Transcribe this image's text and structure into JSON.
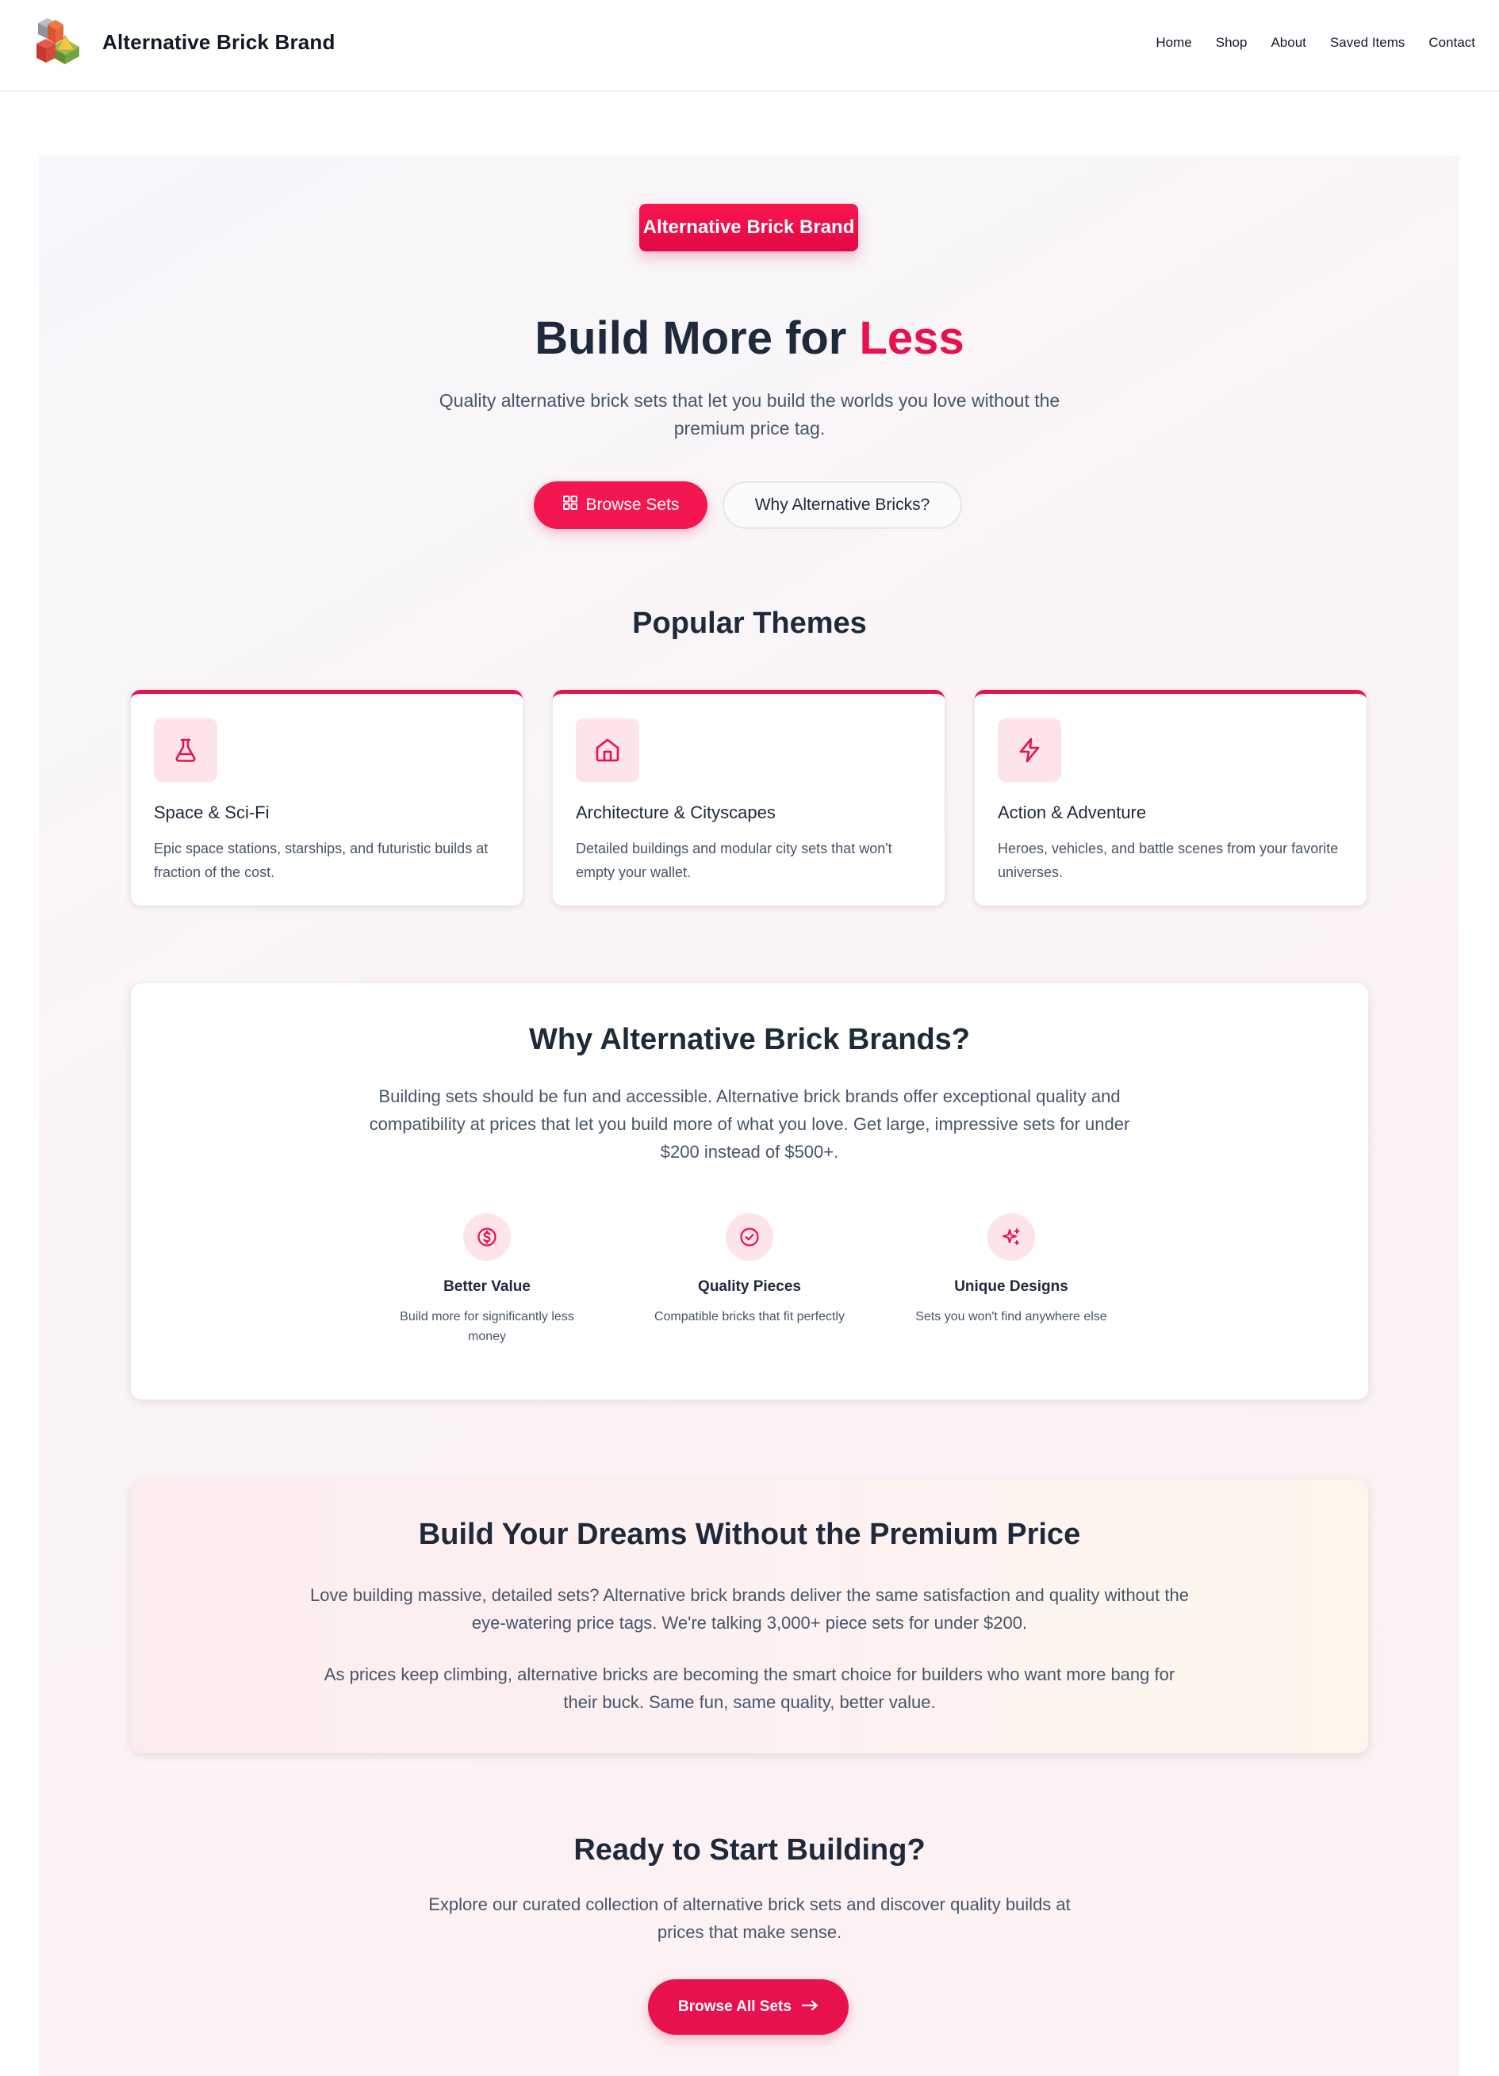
{
  "header": {
    "brand": "Alternative Brick Brand",
    "logo_icon": "brick-stack-logo",
    "nav": [
      "Home",
      "Shop",
      "About",
      "Saved Items",
      "Contact"
    ]
  },
  "hero": {
    "badge": "Alternative Brick Brand",
    "title_main": "Build More for ",
    "title_accent": "Less",
    "subtitle": "Quality alternative brick sets that let you build the worlds you love without the premium price tag.",
    "primary_button": "Browse Sets",
    "primary_button_icon": "grid-icon",
    "secondary_button": "Why Alternative Bricks?"
  },
  "themes": {
    "title": "Popular Themes",
    "cards": [
      {
        "icon": "flask-icon",
        "title": "Space & Sci-Fi",
        "description": "Epic space stations, starships, and futuristic builds at fraction of the cost."
      },
      {
        "icon": "house-icon",
        "title": "Architecture & Cityscapes",
        "description": "Detailed buildings and modular city sets that won't empty your wallet."
      },
      {
        "icon": "lightning-icon",
        "title": "Action & Adventure",
        "description": "Heroes, vehicles, and battle scenes from your favorite universes."
      }
    ]
  },
  "why": {
    "title": "Why Alternative Brick Brands?",
    "text": "Building sets should be fun and accessible. Alternative brick brands offer exceptional quality and compatibility at prices that let you build more of what you love. Get large, impressive sets for under $200 instead of $500+.",
    "features": [
      {
        "icon": "dollar-icon",
        "title": "Better Value",
        "description": "Build more for significantly less money"
      },
      {
        "icon": "check-circle-icon",
        "title": "Quality Pieces",
        "description": "Compatible bricks that fit perfectly"
      },
      {
        "icon": "sparkles-icon",
        "title": "Unique Designs",
        "description": "Sets you won't find anywhere else"
      }
    ]
  },
  "dreams": {
    "title": "Build Your Dreams Without the Premium Price",
    "p1": "Love building massive, detailed sets? Alternative brick brands deliver the same satisfaction and quality without the eye-watering price tags. We're talking 3,000+ piece sets for under $200.",
    "p2": "As prices keep climbing, alternative bricks are becoming the smart choice for builders who want more bang for their buck. Same fun, same quality, better value."
  },
  "cta": {
    "title": "Ready to Start Building?",
    "text": "Explore our curated collection of alternative brick sets and discover quality builds at prices that make sense.",
    "button": "Browse All Sets",
    "button_icon": "arrow-right-icon"
  },
  "colors": {
    "accent": "#e8114d",
    "accent_light": "#fde4e8",
    "heading": "#1e293b",
    "body_text": "#475569"
  }
}
